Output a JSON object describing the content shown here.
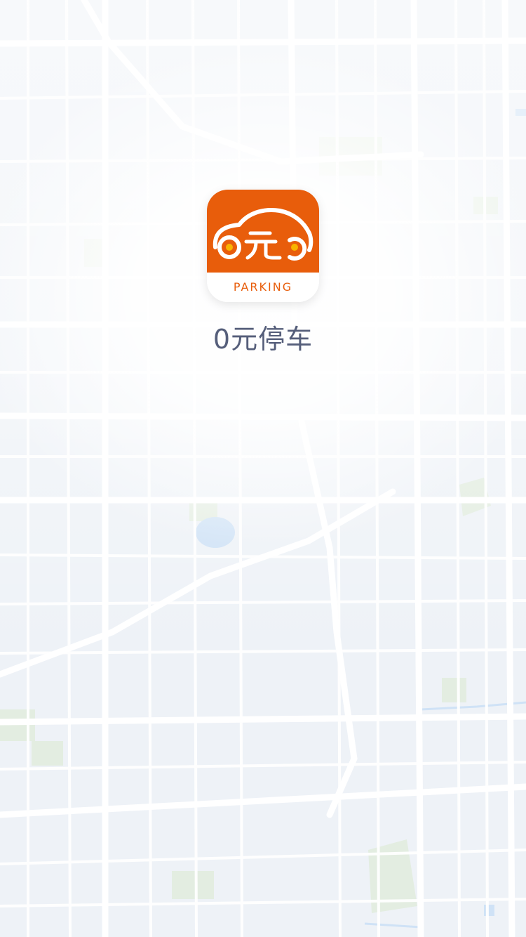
{
  "splash": {
    "app_name": "0元停车",
    "logo_text": "PARKING",
    "brand_color": "#e85d0b",
    "text_color": "#555e7a",
    "logo_icon": "car-icon"
  },
  "background": {
    "type": "map",
    "road_color": "#ffffff",
    "water_color": "#cfe3f7",
    "park_color": "#e5efe2"
  }
}
